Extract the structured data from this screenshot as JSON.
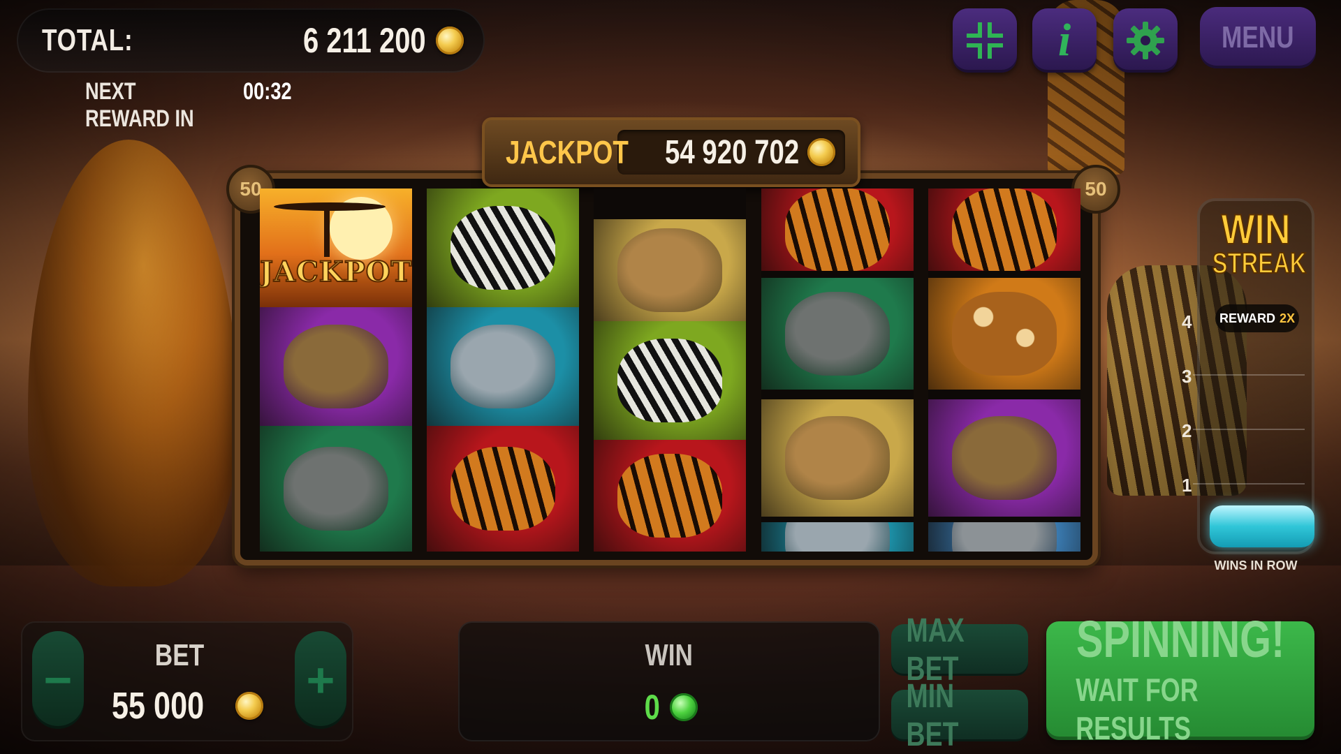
{
  "header": {
    "total_label": "TOTAL:",
    "total_value": "6 211 200",
    "next_reward_label": "NEXT REWARD IN",
    "next_reward_time": "00:32",
    "menu_label": "MENU",
    "info_label": "i"
  },
  "jackpot": {
    "label": "JACKPOT",
    "value": "54 920 702"
  },
  "paylines": {
    "left": "50",
    "right": "50"
  },
  "reels": [
    [
      {
        "symbol": "jackpot",
        "label": "JACKPOT"
      },
      {
        "symbol": "lion"
      },
      {
        "symbol": "elephant"
      }
    ],
    [
      {
        "symbol": "zebra"
      },
      {
        "symbol": "shark"
      },
      {
        "symbol": "tiger"
      }
    ],
    [
      {
        "symbol": "camel"
      },
      {
        "symbol": "zebra"
      },
      {
        "symbol": "tiger"
      }
    ],
    [
      {
        "symbol": "tiger"
      },
      {
        "symbol": "elephant"
      },
      {
        "symbol": "camel"
      },
      {
        "symbol": "shark"
      }
    ],
    [
      {
        "symbol": "tiger"
      },
      {
        "symbol": "giraffe"
      },
      {
        "symbol": "lion"
      },
      {
        "symbol": "rhino"
      }
    ]
  ],
  "symbol_colors": {
    "jackpot": "#f08a1c",
    "lion": "#8a2aa8",
    "elephant": "#1f7a4c",
    "zebra": "#7ea820",
    "shark": "#1c8fa6",
    "tiger": "#b8161c",
    "camel": "#c9a84a",
    "giraffe": "#d07a18",
    "rhino": "#3a7ab0"
  },
  "win_streak": {
    "title_line1": "WIN",
    "title_line2": "STREAK",
    "reward_label": "REWARD",
    "reward_multiplier": "2X",
    "ticks": [
      "4",
      "3",
      "2",
      "1"
    ],
    "wins_in_row_label": "WINS IN ROW"
  },
  "controls": {
    "bet_label": "BET",
    "bet_value": "55 000",
    "minus_label": "−",
    "plus_label": "+",
    "win_label": "WIN",
    "win_value": "0",
    "max_bet_label": "MAX BET",
    "min_bet_label": "MIN BET",
    "spin_title": "SPINNING!",
    "spin_subtitle": "WAIT FOR RESULTS"
  },
  "colors": {
    "accent_gold": "#ffc64a",
    "button_purple": "#3b2266",
    "spin_green": "#3cb84a",
    "win_green": "#5edc4a"
  }
}
